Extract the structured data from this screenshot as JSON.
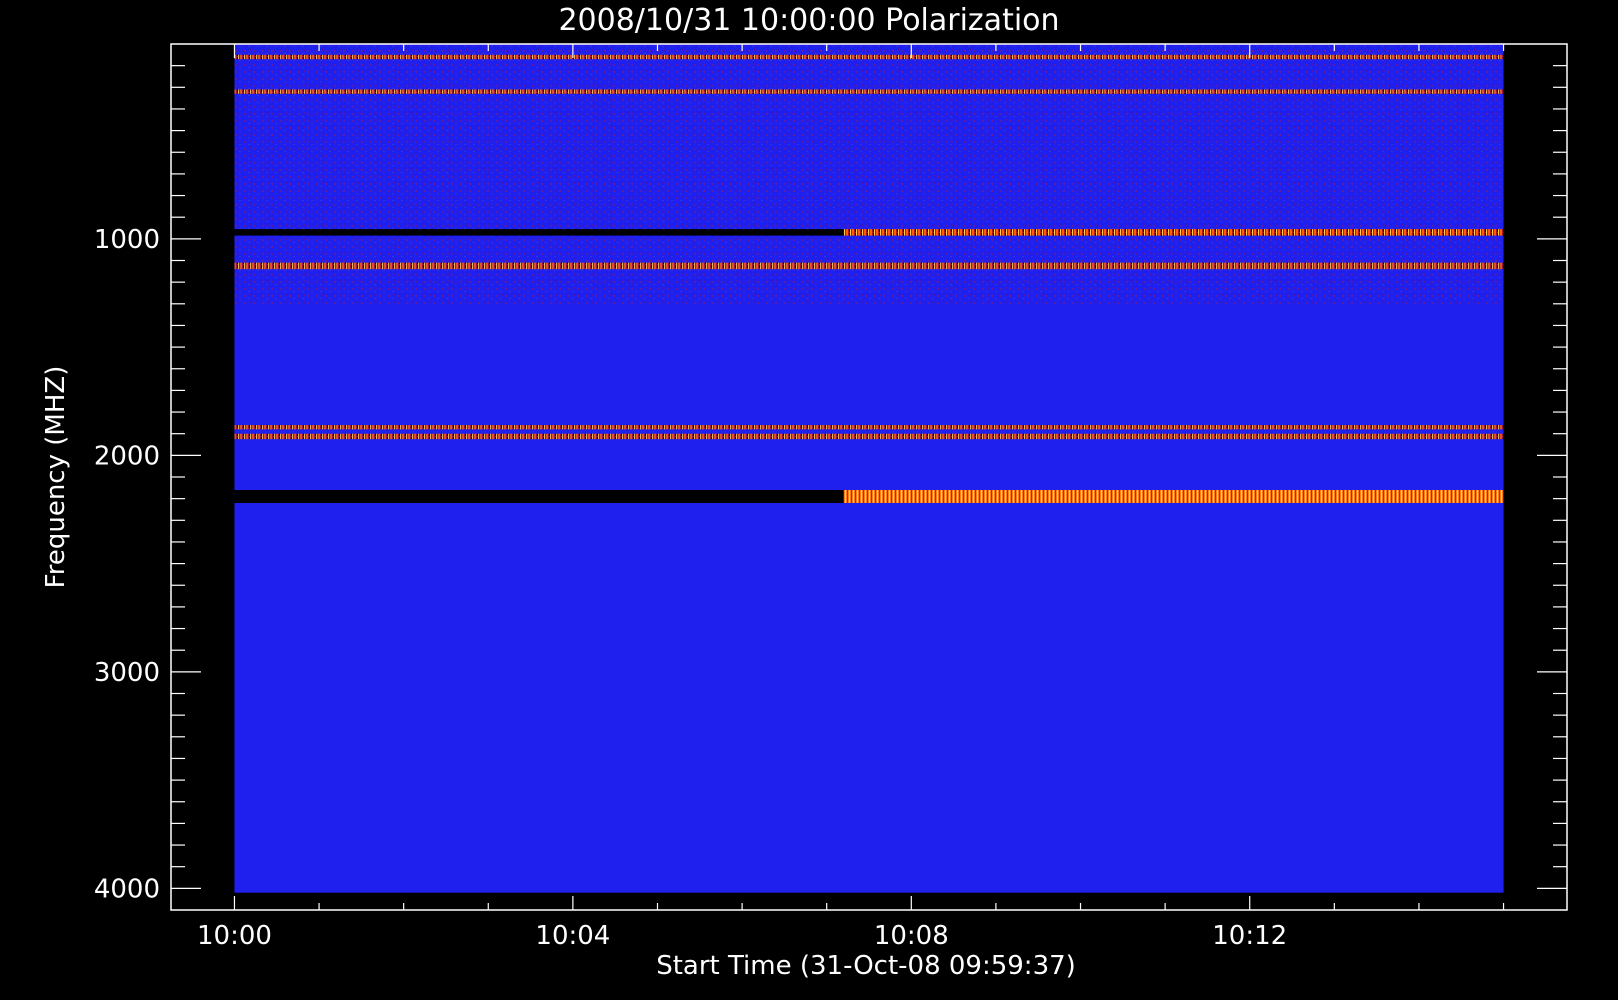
{
  "chart_data": {
    "type": "heatmap",
    "title": "2008/10/31 10:00:00 Polarization",
    "xlabel": "Start Time (31-Oct-08 09:59:37)",
    "ylabel": "Frequency (MHZ)",
    "x_ticks": [
      {
        "label": "10:00",
        "minute": 0
      },
      {
        "label": "10:04",
        "minute": 4
      },
      {
        "label": "10:08",
        "minute": 8
      },
      {
        "label": "10:12",
        "minute": 12
      }
    ],
    "y_ticks": [
      {
        "label": "1000",
        "mhz": 1000
      },
      {
        "label": "2000",
        "mhz": 2000
      },
      {
        "label": "3000",
        "mhz": 3000
      },
      {
        "label": "4000",
        "mhz": 4000
      }
    ],
    "x_range_minutes": [
      -0.75,
      15.75
    ],
    "y_range_mhz": [
      100,
      4100
    ],
    "data_extent_minutes": [
      0,
      15
    ],
    "data_extent_mhz": [
      100,
      4020
    ],
    "background_color": "#2020ee",
    "features": [
      {
        "name": "RFI band",
        "mhz": [
          150,
          170
        ],
        "minutes": [
          0,
          15
        ],
        "intensity": "mixed red/orange speckle"
      },
      {
        "name": "RFI band",
        "mhz": [
          310,
          330
        ],
        "minutes": [
          0,
          15
        ],
        "intensity": "bright yellow speckle"
      },
      {
        "name": "RFI band",
        "mhz": [
          955,
          985
        ],
        "minutes": [
          0,
          15
        ],
        "intensity": "dark then red/orange after 10:07"
      },
      {
        "name": "RFI band",
        "mhz": [
          1110,
          1140
        ],
        "minutes": [
          0,
          15
        ],
        "intensity": "orange speckle"
      },
      {
        "name": "RFI band",
        "mhz": [
          1860,
          1880
        ],
        "minutes": [
          0,
          15
        ],
        "intensity": "red, dark segments"
      },
      {
        "name": "RFI band",
        "mhz": [
          1900,
          1925
        ],
        "minutes": [
          0,
          15
        ],
        "intensity": "red/black segments"
      },
      {
        "name": "RFI band",
        "mhz": [
          2160,
          2220
        ],
        "minutes": [
          0,
          15
        ],
        "intensity": "black to 10:07, orange/yellow after"
      }
    ]
  }
}
